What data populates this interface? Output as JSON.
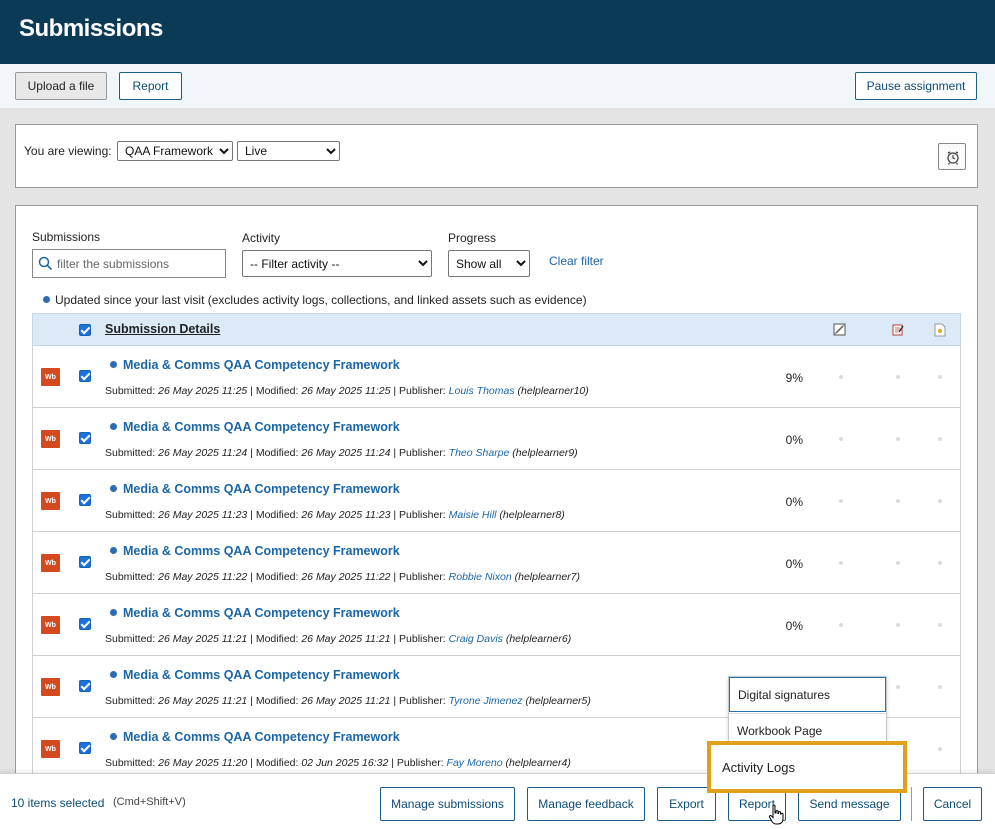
{
  "header": {
    "title": "Submissions"
  },
  "toolbar": {
    "upload_label": "Upload a file",
    "report_label": "Report",
    "pause_label": "Pause assignment"
  },
  "viewing": {
    "label": "You are viewing:",
    "framework_value": "QAA Framework",
    "status_value": "Live"
  },
  "filters": {
    "submissions_label": "Submissions",
    "search_placeholder": "filter the submissions",
    "activity_label": "Activity",
    "activity_value": "-- Filter activity --",
    "progress_label": "Progress",
    "progress_value": "Show all",
    "clear_label": "Clear filter"
  },
  "legend_text": "Updated since your last visit (excludes activity logs, collections, and linked assets such as evidence)",
  "table": {
    "header_label": "Submission Details",
    "badge": "Wb",
    "rows": [
      {
        "title": "Media & Comms QAA Competency Framework",
        "submitted_label": "Submitted:",
        "submitted": "26 May 2025 11:25",
        "modified_label": "| Modified:",
        "modified": "26 May 2025 11:25",
        "publisher_label": "| Publisher:",
        "publisher": "Louis Thomas",
        "username": "(helplearner10)",
        "progress": "9%"
      },
      {
        "title": "Media & Comms QAA Competency Framework",
        "submitted_label": "Submitted:",
        "submitted": "26 May 2025 11:24",
        "modified_label": "| Modified:",
        "modified": "26 May 2025 11:24",
        "publisher_label": "| Publisher:",
        "publisher": "Theo Sharpe",
        "username": "(helplearner9)",
        "progress": "0%"
      },
      {
        "title": "Media & Comms QAA Competency Framework",
        "submitted_label": "Submitted:",
        "submitted": "26 May 2025 11:23",
        "modified_label": "| Modified:",
        "modified": "26 May 2025 11:23",
        "publisher_label": "| Publisher:",
        "publisher": "Maisie Hill",
        "username": "(helplearner8)",
        "progress": "0%"
      },
      {
        "title": "Media & Comms QAA Competency Framework",
        "submitted_label": "Submitted:",
        "submitted": "26 May 2025 11:22",
        "modified_label": "| Modified:",
        "modified": "26 May 2025 11:22",
        "publisher_label": "| Publisher:",
        "publisher": "Robbie Nixon",
        "username": "(helplearner7)",
        "progress": "0%"
      },
      {
        "title": "Media & Comms QAA Competency Framework",
        "submitted_label": "Submitted:",
        "submitted": "26 May 2025 11:21",
        "modified_label": "| Modified:",
        "modified": "26 May 2025 11:21",
        "publisher_label": "| Publisher:",
        "publisher": "Craig Davis",
        "username": "(helplearner6)",
        "progress": "0%"
      },
      {
        "title": "Media & Comms QAA Competency Framework",
        "submitted_label": "Submitted:",
        "submitted": "26 May 2025 11:21",
        "modified_label": "| Modified:",
        "modified": "26 May 2025 11:21",
        "publisher_label": "| Publisher:",
        "publisher": "Tyrone Jimenez",
        "username": "(helplearner5)",
        "progress": ""
      },
      {
        "title": "Media & Comms QAA Competency Framework",
        "submitted_label": "Submitted:",
        "submitted": "26 May 2025 11:20",
        "modified_label": "| Modified:",
        "modified": "02 Jun 2025 16:32",
        "publisher_label": "| Publisher:",
        "publisher": "Fay Moreno",
        "username": "(helplearner4)",
        "progress": ""
      }
    ]
  },
  "report_menu": {
    "items": [
      "Digital signatures",
      "Workbook Page",
      "Activity Logs"
    ]
  },
  "footer": {
    "selected_text": "10 items selected",
    "shortcut_text": "(Cmd+Shift+V)",
    "manage_submissions": "Manage submissions",
    "manage_feedback": "Manage feedback",
    "export": "Export",
    "report": "Report",
    "send_message": "Send message",
    "cancel": "Cancel"
  },
  "colors": {
    "header_bg": "#0b3a57",
    "accent": "#1b66a6",
    "highlight": "#e0a019",
    "badge": "#d24a1e"
  }
}
